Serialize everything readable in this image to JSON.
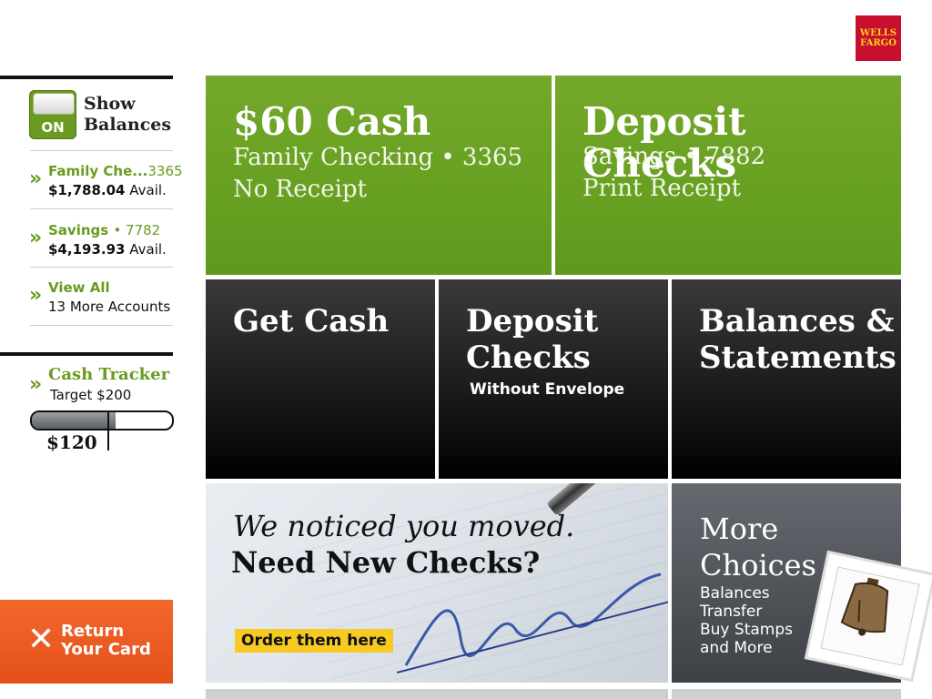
{
  "brand": {
    "logo_text_1": "WELLS",
    "logo_text_2": "FARGO"
  },
  "sidebar": {
    "toggle": {
      "state": "ON",
      "label_1": "Show",
      "label_2": "Balances"
    },
    "accounts": [
      {
        "name": "Family Che...",
        "number": "3365",
        "balance": "$1,788.04",
        "avail": "Avail."
      },
      {
        "name": "Savings",
        "number": "• 7782",
        "balance": "$4,193.93",
        "avail": "Avail."
      }
    ],
    "view_all": {
      "label": "View All",
      "sub": "13 More Accounts"
    },
    "cash_tracker": {
      "title": "Cash Tracker",
      "target": "Target $200",
      "value": "$120",
      "progress_fraction": 0.6
    },
    "return_card": {
      "line1": "Return",
      "line2": "Your Card"
    }
  },
  "tiles": {
    "fast_cash": {
      "title": "$60 Cash",
      "line1": "Family Checking • 3365",
      "line2": "No Receipt"
    },
    "fast_deposit": {
      "title": "Deposit Checks",
      "line1": "Savings • 7882",
      "line2": "Print Receipt"
    },
    "get_cash": {
      "title": "Get Cash"
    },
    "deposit_checks": {
      "title_1": "Deposit",
      "title_2": "Checks",
      "sub": "Without Envelope"
    },
    "balances": {
      "title_1": "Balances &",
      "title_2": "Statements"
    },
    "ad": {
      "line1": "We noticed you moved.",
      "line2": "Need New Checks?",
      "button": "Order them here"
    },
    "more_choices": {
      "title_1": "More",
      "title_2": "Choices",
      "items": [
        "Balances",
        "Transfer",
        "Buy Stamps",
        "and More"
      ]
    }
  },
  "colors": {
    "green": "#6a9a1f",
    "orange": "#e95a22",
    "dark": "#1b1b1b",
    "yellow": "#f7c923"
  }
}
